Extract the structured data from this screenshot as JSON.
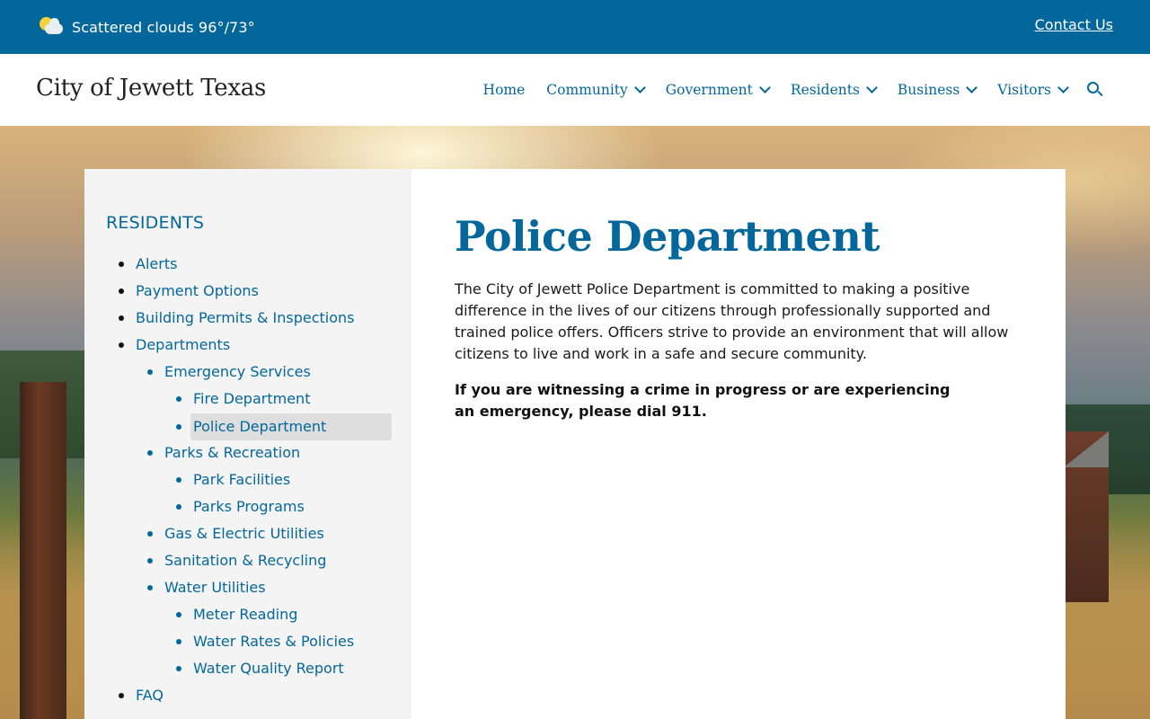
{
  "topbar": {
    "weather_icon": "partly-cloudy-icon",
    "weather_text": "Scattered clouds 96°/73°",
    "contact_label": "Contact Us"
  },
  "header": {
    "site_title": "City of Jewett Texas",
    "nav": [
      {
        "label": "Home",
        "dropdown": false
      },
      {
        "label": "Community",
        "dropdown": true
      },
      {
        "label": "Government",
        "dropdown": true
      },
      {
        "label": "Residents",
        "dropdown": true
      },
      {
        "label": "Business",
        "dropdown": true
      },
      {
        "label": "Visitors",
        "dropdown": true
      }
    ],
    "search_icon": "search-icon"
  },
  "sidebar": {
    "heading": "RESIDENTS",
    "items": [
      {
        "label": "Alerts",
        "level": 1
      },
      {
        "label": "Payment Options",
        "level": 1
      },
      {
        "label": "Building Permits & Inspections",
        "level": 1
      },
      {
        "label": "Departments",
        "level": 1
      },
      {
        "label": "Emergency Services",
        "level": 2
      },
      {
        "label": "Fire Department",
        "level": 3
      },
      {
        "label": "Police Department",
        "level": 3,
        "active": true
      },
      {
        "label": "Parks & Recreation",
        "level": 2
      },
      {
        "label": "Park Facilities",
        "level": 3
      },
      {
        "label": "Parks Programs",
        "level": 3
      },
      {
        "label": "Gas & Electric Utilities",
        "level": 2
      },
      {
        "label": "Sanitation & Recycling",
        "level": 2
      },
      {
        "label": "Water Utilities",
        "level": 2
      },
      {
        "label": "Meter Reading",
        "level": 3
      },
      {
        "label": "Water Rates & Policies",
        "level": 3
      },
      {
        "label": "Water Quality Report",
        "level": 3
      },
      {
        "label": "FAQ",
        "level": 1
      }
    ]
  },
  "main": {
    "title": "Police Department",
    "intro": "The City of Jewett Police Department is committed to making a positive difference in the lives of our citizens through professionally supported and trained police offers. Officers strive to provide an environment that will allow citizens to live and work in a safe and secure community.",
    "alert": "If you are witnessing a crime in progress or are experiencing an emergency, please dial 911."
  },
  "colors": {
    "brand_blue": "#04679b",
    "sidebar_bg": "#f4f4f4",
    "active_item_bg": "#dedede"
  }
}
